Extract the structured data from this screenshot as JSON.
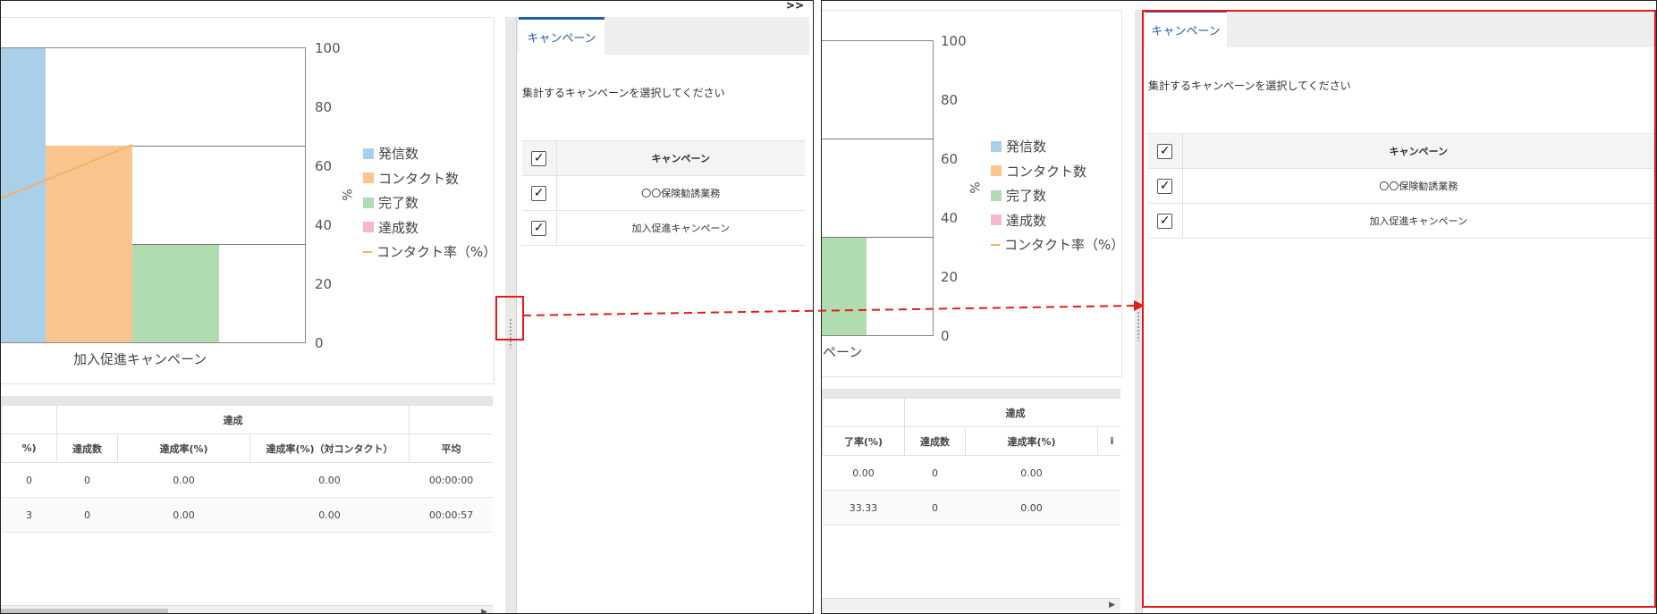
{
  "left": {
    "toggle_label": ">>",
    "axis_unit": "%",
    "yticks": [
      "100",
      "80",
      "60",
      "40",
      "20",
      "0"
    ],
    "category_label": "加入促進キャンペーン",
    "legend": [
      {
        "label": "発信数",
        "color": "#aacfe9",
        "type": "box"
      },
      {
        "label": "コンタクト数",
        "color": "#fbc58f",
        "type": "box"
      },
      {
        "label": "完了数",
        "color": "#b1dcb1",
        "type": "box"
      },
      {
        "label": "達成数",
        "color": "#f5b9cd",
        "type": "box"
      },
      {
        "label": "コンタクト率（%）",
        "color": "#f3b267",
        "type": "line"
      }
    ],
    "grid": {
      "group_header": "達成",
      "columns": [
        "%)",
        "達成数",
        "達成率(%)",
        "達成率(%)（対コンタクト）",
        "平均"
      ],
      "rows": [
        [
          "0",
          "0",
          "0.00",
          "0.00",
          "00:00:00"
        ],
        [
          "3",
          "0",
          "0.00",
          "0.00",
          "00:00:57"
        ]
      ]
    },
    "tab_label": "キャンペーン",
    "instruction": "集計するキャンペーンを選択してください",
    "campaign_header": "キャンペーン",
    "campaigns": [
      "〇〇保険勧誘業務",
      "加入促進キャンペーン"
    ]
  },
  "right": {
    "axis_unit": "%",
    "yticks": [
      "100",
      "80",
      "60",
      "40",
      "20",
      "0"
    ],
    "category_label": "ペーン",
    "legend": [
      {
        "label": "発信数",
        "color": "#aacfe9",
        "type": "box"
      },
      {
        "label": "コンタクト数",
        "color": "#fbc58f",
        "type": "box"
      },
      {
        "label": "完了数",
        "color": "#b1dcb1",
        "type": "box"
      },
      {
        "label": "達成数",
        "color": "#f5b9cd",
        "type": "box"
      },
      {
        "label": "コンタクト率（%）",
        "color": "#f3b267",
        "type": "line"
      }
    ],
    "grid": {
      "group_header": "達成",
      "columns": [
        "了率(%)",
        "達成数",
        "達成率(%)",
        "i"
      ],
      "rows": [
        [
          "0.00",
          "0",
          "0.00",
          ""
        ],
        [
          "33.33",
          "0",
          "0.00",
          ""
        ]
      ]
    },
    "tab_label": "キャンペーン",
    "instruction": "集計するキャンペーンを選択してください",
    "campaign_header": "キャンペーン",
    "campaigns": [
      "〇〇保険勧誘業務",
      "加入促進キャンペーン"
    ]
  },
  "chart_data": [
    {
      "type": "bar",
      "categories": [
        "加入促進キャンペーン"
      ],
      "ylim": [
        0,
        100
      ],
      "ylabel": "%",
      "series": [
        {
          "name": "発信数",
          "values": [
            100
          ]
        },
        {
          "name": "コンタクト数",
          "values": [
            67
          ]
        },
        {
          "name": "完了数",
          "values": [
            33
          ]
        },
        {
          "name": "達成数",
          "values": [
            0
          ]
        },
        {
          "name": "コンタクト率（%）",
          "values": [
            67
          ]
        }
      ],
      "legend": "right",
      "grid": true
    },
    {
      "type": "bar",
      "categories": [
        "加入促進キャンペーン"
      ],
      "ylim": [
        0,
        100
      ],
      "ylabel": "%",
      "series": [
        {
          "name": "完了数",
          "values": [
            33
          ]
        }
      ],
      "legend": "right",
      "grid": true
    }
  ],
  "colors": {
    "accent": "#1f5fa8",
    "highlight": "#e31b1b"
  }
}
